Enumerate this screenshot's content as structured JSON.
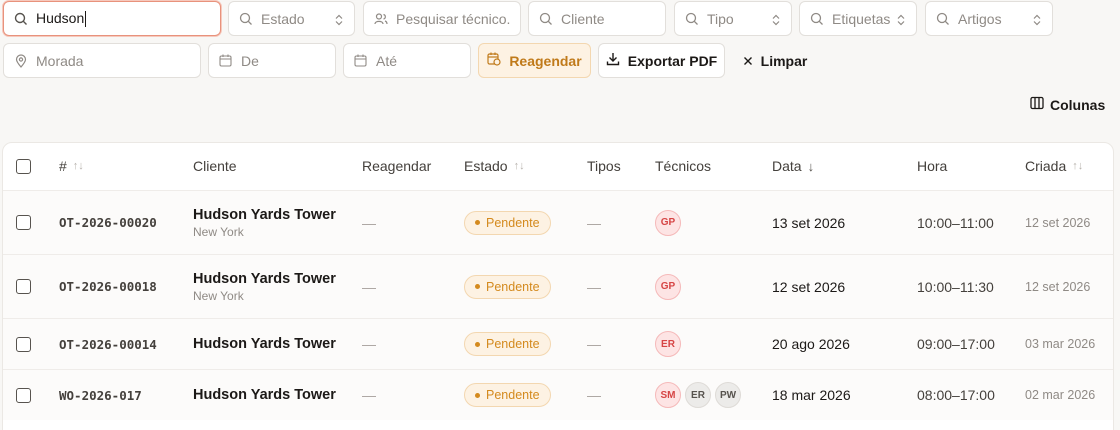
{
  "filters": {
    "search_value": "Hudson",
    "estado": "Estado",
    "tecnico": "Pesquisar técnico...",
    "cliente": "Cliente",
    "tipo": "Tipo",
    "etiquetas": "Etiquetas",
    "artigos": "Artigos",
    "morada": "Morada",
    "de": "De",
    "ate": "Até"
  },
  "actions": {
    "reagendar": "Reagendar",
    "exportar_pdf": "Exportar PDF",
    "limpar": "Limpar",
    "colunas": "Colunas"
  },
  "table": {
    "headers": {
      "id": "#",
      "cliente": "Cliente",
      "reagendar": "Reagendar",
      "estado": "Estado",
      "tipos": "Tipos",
      "tecnicos": "Técnicos",
      "data": "Data",
      "hora": "Hora",
      "criada": "Criada"
    },
    "rows": [
      {
        "id": "OT-2026-00020",
        "client": "Hudson Yards Tower",
        "city": "New York",
        "reagendar": "—",
        "status": "Pendente",
        "tipos": "—",
        "techs": [
          "GP"
        ],
        "date": "13 set 2026",
        "hour": "10:00–11:00",
        "created": "12 set 2026"
      },
      {
        "id": "OT-2026-00018",
        "client": "Hudson Yards Tower",
        "city": "New York",
        "reagendar": "—",
        "status": "Pendente",
        "tipos": "—",
        "techs": [
          "GP"
        ],
        "date": "12 set 2026",
        "hour": "10:00–11:30",
        "created": "12 set 2026"
      },
      {
        "id": "OT-2026-00014",
        "client": "Hudson Yards Tower",
        "city": "",
        "reagendar": "—",
        "status": "Pendente",
        "tipos": "—",
        "techs": [
          "ER"
        ],
        "date": "20 ago 2026",
        "hour": "09:00–17:00",
        "created": "03 mar 2026"
      },
      {
        "id": "WO-2026-017",
        "client": "Hudson Yards Tower",
        "city": "",
        "reagendar": "—",
        "status": "Pendente",
        "tipos": "—",
        "techs": [
          "SM",
          "ER",
          "PW"
        ],
        "date": "18 mar 2026",
        "hour": "08:00–17:00",
        "created": "02 mar 2026"
      }
    ]
  },
  "colors": {
    "accent_orange": "#c07a1a",
    "badge_bg": "#fdf2e3",
    "avatar_red": "#d64545",
    "active_border": "#e8927c"
  }
}
